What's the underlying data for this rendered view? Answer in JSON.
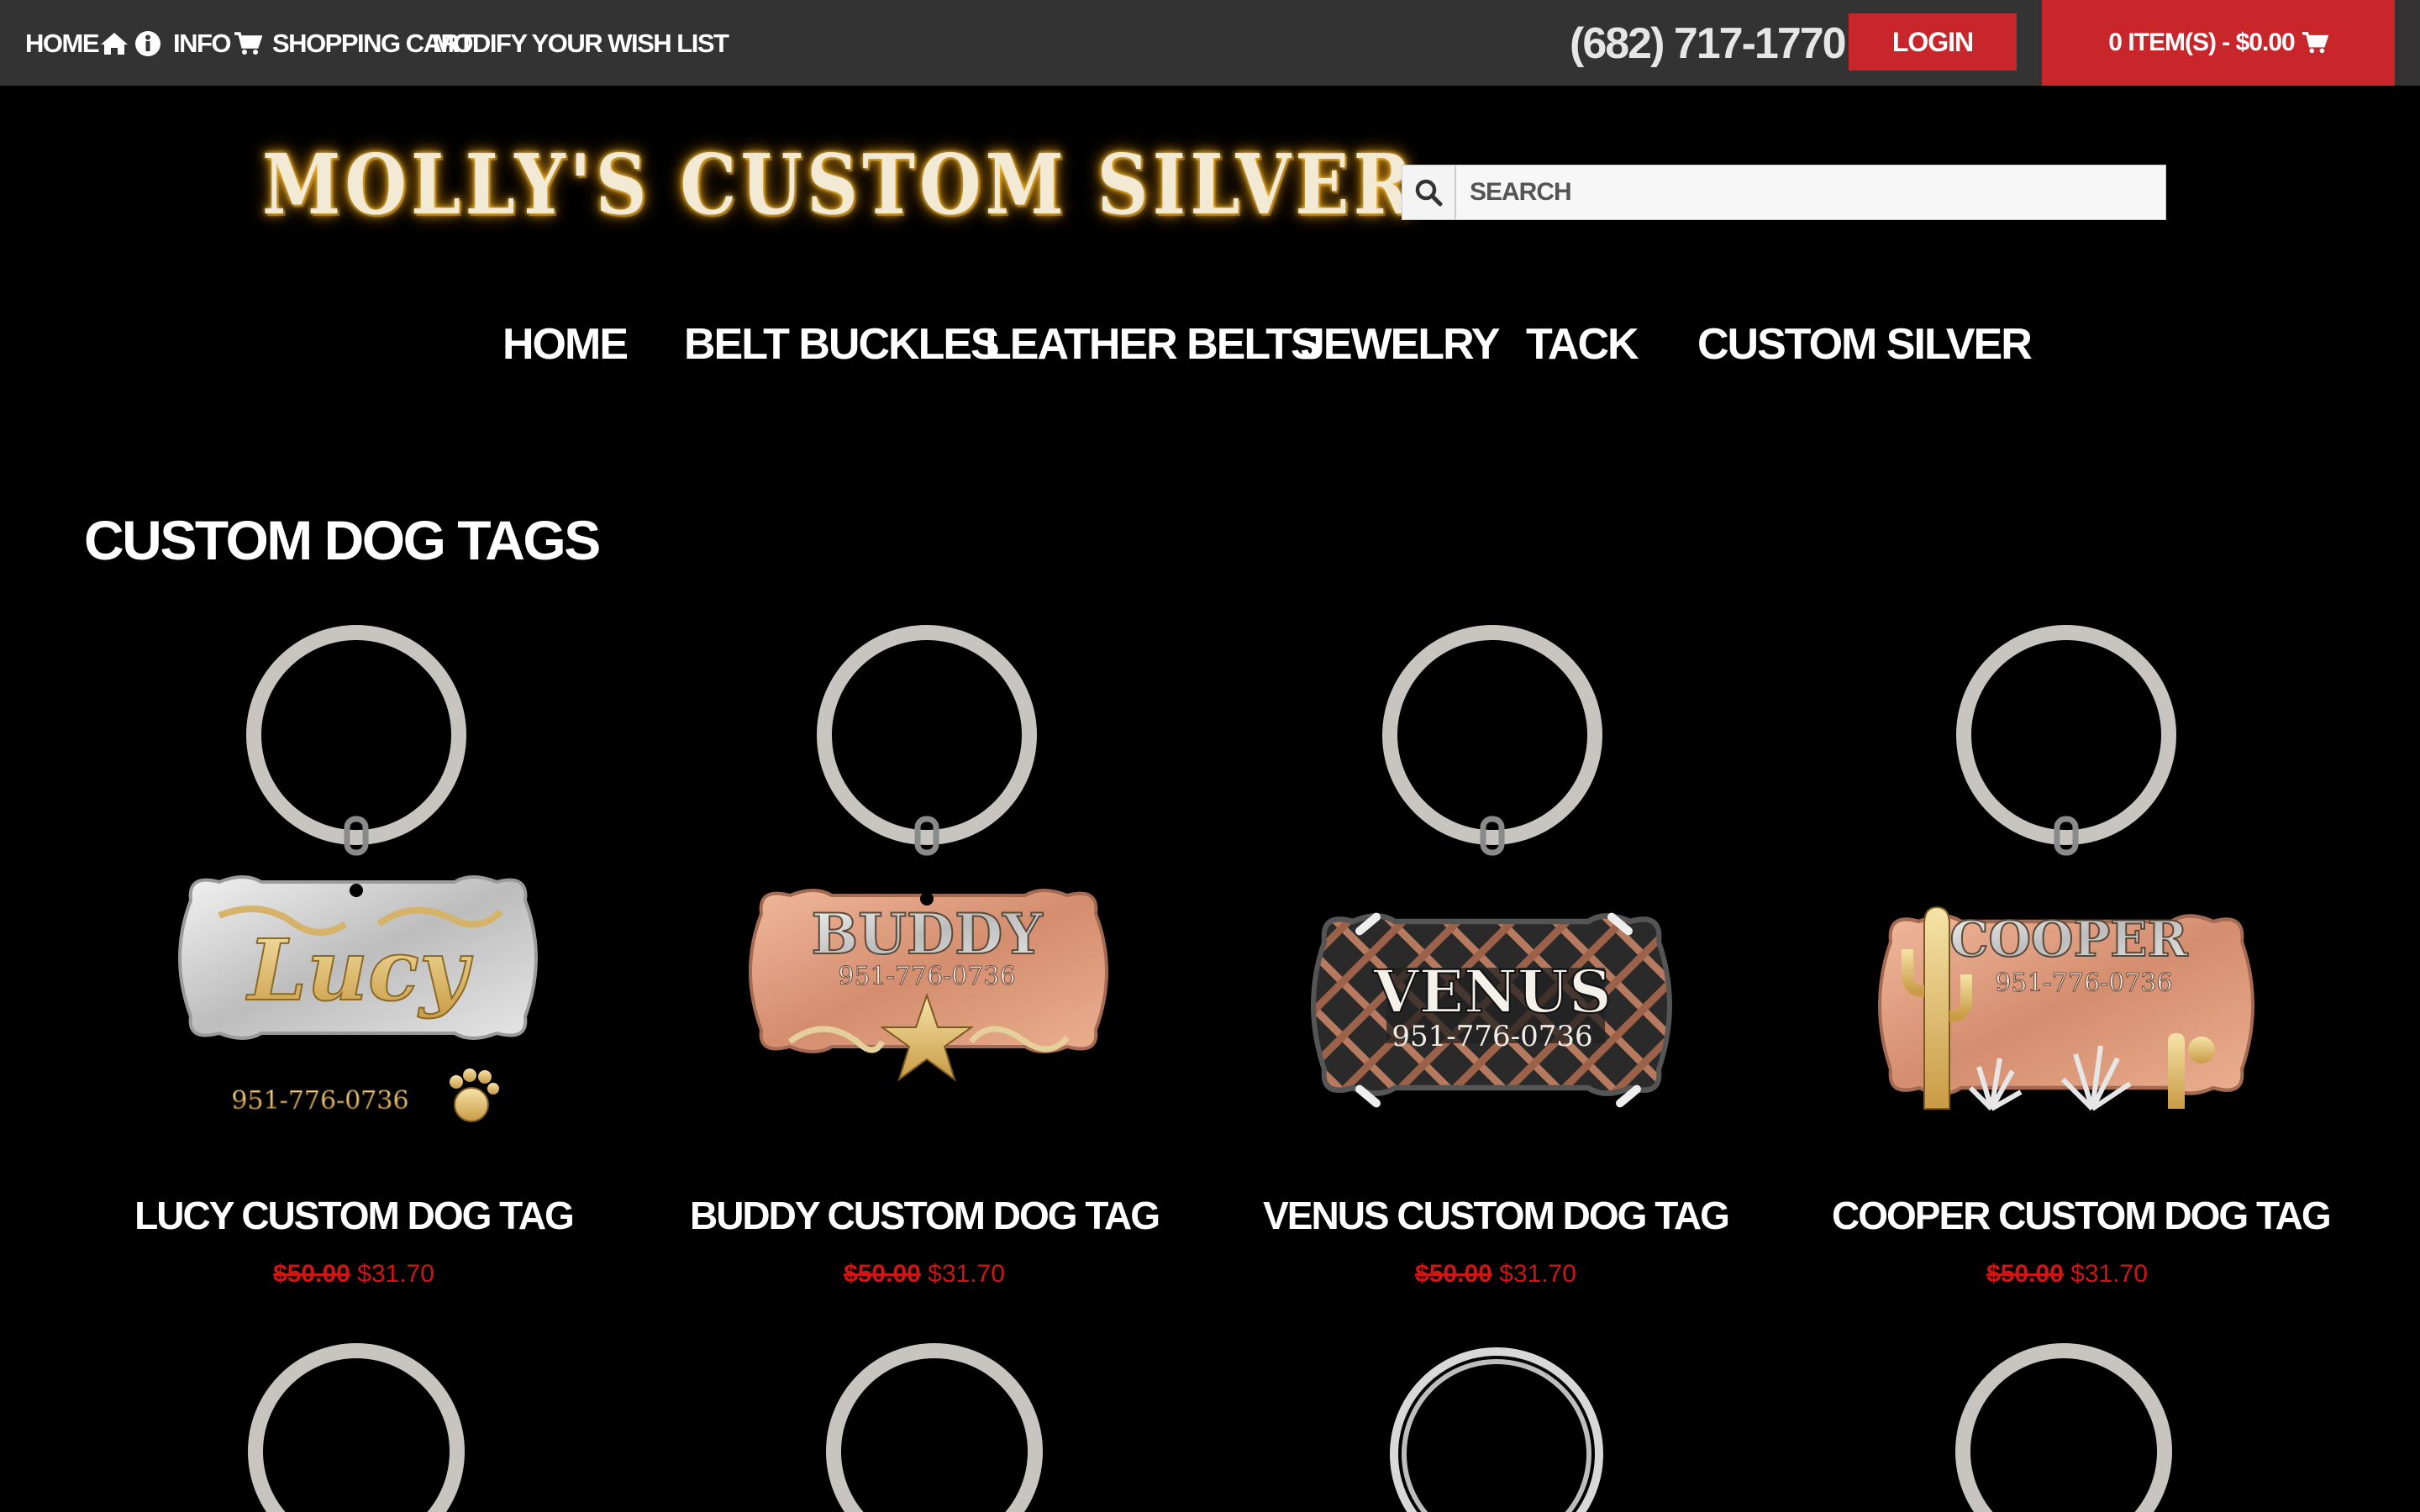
{
  "topbar": {
    "home_label": "HOME",
    "info_label": "INFO",
    "cart_label": "SHOPPING CART",
    "wishlist_label": "MODIFY YOUR WISH LIST",
    "phone": "(682) 717-1770",
    "login_label": "LOGIN",
    "cart_summary": "0 ITEM(S) - $0.00"
  },
  "logo": {
    "text": "MOLLY'S CUSTOM SILVER"
  },
  "search": {
    "placeholder": "SEARCH"
  },
  "mainnav": {
    "items": [
      "HOME",
      "BELT BUCKLES",
      "LEATHER BELTS",
      "JEWELRY",
      "TACK",
      "CUSTOM SILVER"
    ]
  },
  "page": {
    "title": "CUSTOM DOG TAGS"
  },
  "products": [
    {
      "name": "LUCY CUSTOM DOG TAG",
      "old_price": "$50.00",
      "price": "$31.70",
      "tag_text": "Lucy",
      "tag_phone": "951-776-0736"
    },
    {
      "name": "BUDDY CUSTOM DOG TAG",
      "old_price": "$50.00",
      "price": "$31.70",
      "tag_text": "BUDDY",
      "tag_phone": "951-776-0736"
    },
    {
      "name": "VENUS CUSTOM DOG TAG",
      "old_price": "$50.00",
      "price": "$31.70",
      "tag_text": "VENUS",
      "tag_phone": "951-776-0736"
    },
    {
      "name": "COOPER CUSTOM DOG TAG",
      "old_price": "$50.00",
      "price": "$31.70",
      "tag_text": "COOPER",
      "tag_phone": "951-776-0736"
    }
  ],
  "colors": {
    "topbar": "#333333",
    "accent_red": "#c8262b",
    "sale_red": "#d01515",
    "background": "#000000"
  },
  "icons": {
    "home": "home-icon",
    "info": "info-icon",
    "cart": "cart-icon",
    "search": "search-icon"
  }
}
